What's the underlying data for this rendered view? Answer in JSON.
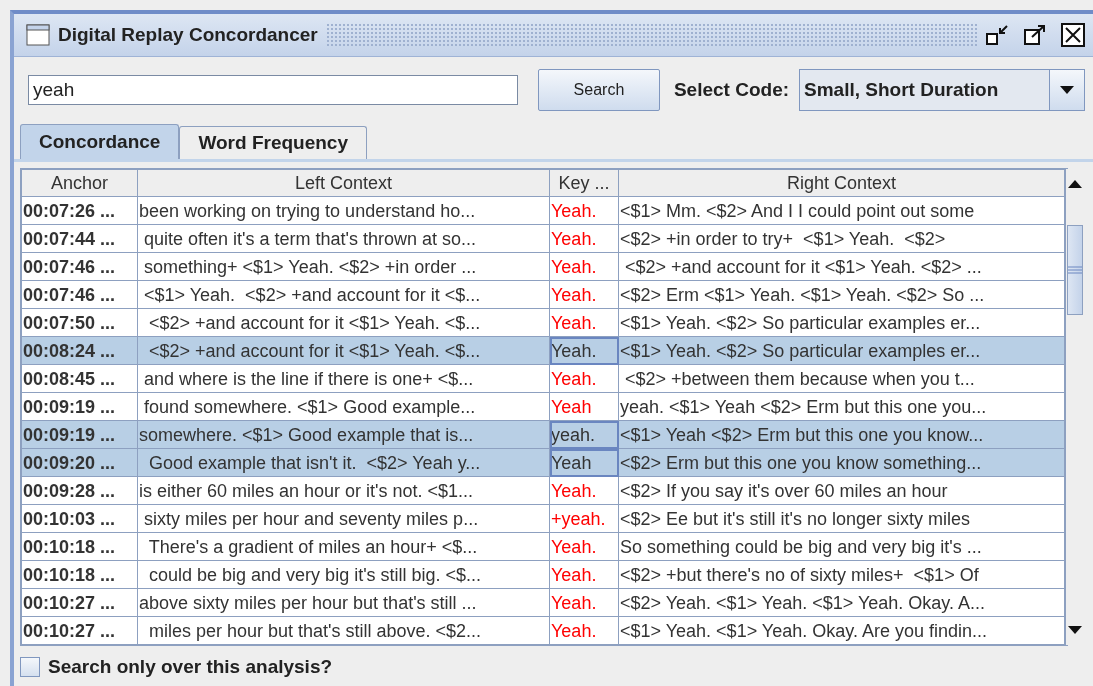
{
  "window": {
    "title": "Digital Replay Concordancer"
  },
  "search": {
    "value": "yeah",
    "button": "Search"
  },
  "code_select": {
    "label": "Select Code:",
    "value": "Small, Short Duration"
  },
  "tabs": [
    {
      "label": "Concordance",
      "selected": true
    },
    {
      "label": "Word Frequency",
      "selected": false
    }
  ],
  "table": {
    "columns": [
      "Anchor",
      "Left Context",
      "Key ...",
      "Right Context"
    ],
    "rows": [
      {
        "anchor": "00:07:26 ...",
        "left_context": "been working on trying to understand ho...",
        "key": "Yeah.",
        "right_context": "<$1> Mm. <$2> And I I could point out some",
        "selected": false
      },
      {
        "anchor": "00:07:44 ...",
        "left_context": " quite often it's a term that's thrown at so...",
        "key": "Yeah.",
        "right_context": "<$2> +in order to try+  <$1> Yeah.  <$2>",
        "selected": false
      },
      {
        "anchor": "00:07:46 ...",
        "left_context": " something+ <$1> Yeah. <$2> +in order ...",
        "key": "Yeah.",
        "right_context": " <$2> +and account for it <$1> Yeah. <$2> ...",
        "selected": false
      },
      {
        "anchor": "00:07:46 ...",
        "left_context": " <$1> Yeah.  <$2> +and account for it <$...",
        "key": "Yeah.",
        "right_context": "<$2> Erm <$1> Yeah. <$1> Yeah. <$2> So ...",
        "selected": false
      },
      {
        "anchor": "00:07:50 ...",
        "left_context": "  <$2> +and account for it <$1> Yeah. <$...",
        "key": "Yeah.",
        "right_context": "<$1> Yeah. <$2> So particular examples er...",
        "selected": false
      },
      {
        "anchor": "00:08:24 ...",
        "left_context": "  <$2> +and account for it <$1> Yeah. <$...",
        "key": "Yeah.",
        "right_context": "<$1> Yeah. <$2> So particular examples er...",
        "selected": true
      },
      {
        "anchor": "00:08:45 ...",
        "left_context": " and where is the line if there is one+ <$...",
        "key": "Yeah.",
        "right_context": " <$2> +between them because when you t...",
        "selected": false
      },
      {
        "anchor": "00:09:19 ...",
        "left_context": " found somewhere. <$1> Good example...",
        "key": "Yeah",
        "right_context": "yeah. <$1> Yeah <$2> Erm but this one you...",
        "selected": false
      },
      {
        "anchor": "00:09:19 ...",
        "left_context": "somewhere. <$1> Good example that is...",
        "key": "yeah.",
        "right_context": "<$1> Yeah <$2> Erm but this one you know...",
        "selected": true
      },
      {
        "anchor": "00:09:20 ...",
        "left_context": "  Good example that isn't it.  <$2> Yeah y...",
        "key": "Yeah",
        "right_context": "<$2> Erm but this one you know something...",
        "selected": true
      },
      {
        "anchor": "00:09:28 ...",
        "left_context": "is either 60 miles an hour or it's not. <$1...",
        "key": "Yeah.",
        "right_context": "<$2> If you say it's over 60 miles an hour",
        "selected": false
      },
      {
        "anchor": "00:10:03 ...",
        "left_context": " sixty miles per hour and seventy miles p...",
        "key": "+yeah.",
        "right_context": "<$2> Ee but it's still it's no longer sixty miles",
        "selected": false
      },
      {
        "anchor": "00:10:18 ...",
        "left_context": "  There's a gradient of miles an hour+ <$...",
        "key": "Yeah.",
        "right_context": "So something could be big and very big it's ...",
        "selected": false
      },
      {
        "anchor": "00:10:18 ...",
        "left_context": "  could be big and very big it's still big. <$...",
        "key": "Yeah.",
        "right_context": "<$2> +but there's no of sixty miles+  <$1> Of",
        "selected": false
      },
      {
        "anchor": "00:10:27 ...",
        "left_context": "above sixty miles per hour but that's still ...",
        "key": "Yeah.",
        "right_context": "<$2> Yeah. <$1> Yeah. <$1> Yeah. Okay. A...",
        "selected": false
      },
      {
        "anchor": "00:10:27 ...",
        "left_context": "  miles per hour but that's still above. <$2...",
        "key": "Yeah.",
        "right_context": "<$1> Yeah. <$1> Yeah. Okay. Are you findin...",
        "selected": false
      }
    ]
  },
  "option": {
    "label": "Search only over this analysis?",
    "checked": false
  }
}
